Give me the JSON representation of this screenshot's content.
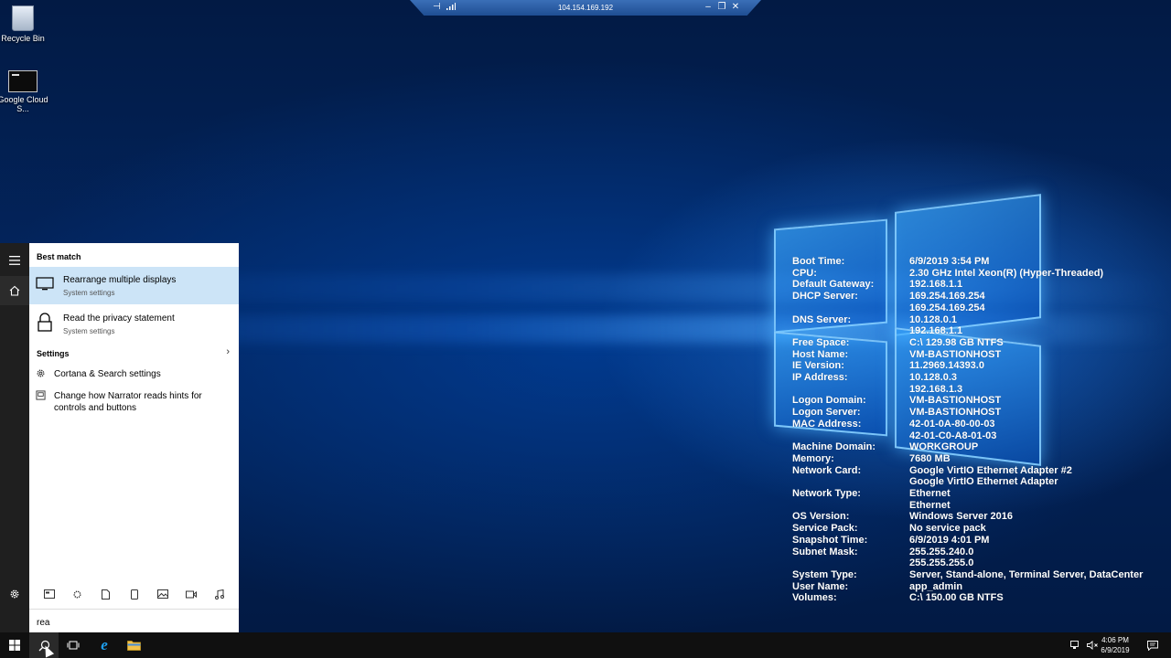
{
  "desktop": {
    "icons": [
      {
        "label": "Recycle Bin"
      },
      {
        "label": "Google Cloud S..."
      }
    ]
  },
  "rdp": {
    "host": "104.154.169.192"
  },
  "bginfo": {
    "rows": [
      {
        "label": "Boot Time:",
        "value": "6/9/2019 3:54 PM"
      },
      {
        "label": "CPU:",
        "value": "2.30 GHz Intel Xeon(R) (Hyper-Threaded)"
      },
      {
        "label": "Default Gateway:",
        "value": "192.168.1.1"
      },
      {
        "label": "DHCP Server:",
        "value": "169.254.169.254"
      },
      {
        "label": "",
        "value": "169.254.169.254"
      },
      {
        "label": "DNS Server:",
        "value": "10.128.0.1"
      },
      {
        "label": "",
        "value": "192.168.1.1"
      },
      {
        "label": "Free Space:",
        "value": "C:\\ 129.98 GB NTFS"
      },
      {
        "label": "Host Name:",
        "value": "VM-BASTIONHOST"
      },
      {
        "label": "IE Version:",
        "value": "11.2969.14393.0"
      },
      {
        "label": "IP Address:",
        "value": "10.128.0.3"
      },
      {
        "label": "",
        "value": "192.168.1.3"
      },
      {
        "label": "Logon Domain:",
        "value": "VM-BASTIONHOST"
      },
      {
        "label": "Logon Server:",
        "value": "VM-BASTIONHOST"
      },
      {
        "label": "MAC Address:",
        "value": "42-01-0A-80-00-03"
      },
      {
        "label": "",
        "value": "42-01-C0-A8-01-03"
      },
      {
        "label": "Machine Domain:",
        "value": "WORKGROUP"
      },
      {
        "label": "Memory:",
        "value": "7680 MB"
      },
      {
        "label": "Network Card:",
        "value": "Google VirtIO Ethernet Adapter #2"
      },
      {
        "label": "",
        "value": "Google VirtIO Ethernet Adapter"
      },
      {
        "label": "Network Type:",
        "value": "Ethernet"
      },
      {
        "label": "",
        "value": "Ethernet"
      },
      {
        "label": "OS Version:",
        "value": "Windows Server 2016"
      },
      {
        "label": "Service Pack:",
        "value": "No service pack"
      },
      {
        "label": "Snapshot Time:",
        "value": "6/9/2019 4:01 PM"
      },
      {
        "label": "Subnet Mask:",
        "value": "255.255.240.0"
      },
      {
        "label": "",
        "value": "255.255.255.0"
      },
      {
        "label": "System Type:",
        "value": "Server, Stand-alone, Terminal Server, DataCenter"
      },
      {
        "label": "User Name:",
        "value": "app_admin"
      },
      {
        "label": "Volumes:",
        "value": "C:\\ 150.00 GB NTFS"
      }
    ]
  },
  "search": {
    "best_match_heading": "Best match",
    "results": [
      {
        "title": "Rearrange multiple displays",
        "subtitle": "System settings",
        "icon": "monitor-icon"
      },
      {
        "title": "Read the privacy statement",
        "subtitle": "System settings",
        "icon": "lock-icon"
      }
    ],
    "settings_heading": "Settings",
    "settings_items": [
      {
        "text": "Cortana & Search settings",
        "icon": "gear-icon"
      },
      {
        "text": "Change how Narrator reads hints for controls and buttons",
        "icon": "narrator-icon"
      }
    ],
    "query": "rea"
  },
  "taskbar": {
    "time": "4:06 PM",
    "date": "6/9/2019"
  },
  "colors": {
    "accent": "#0078d7",
    "selected": "#cce4f7",
    "taskbar": "#101010"
  }
}
